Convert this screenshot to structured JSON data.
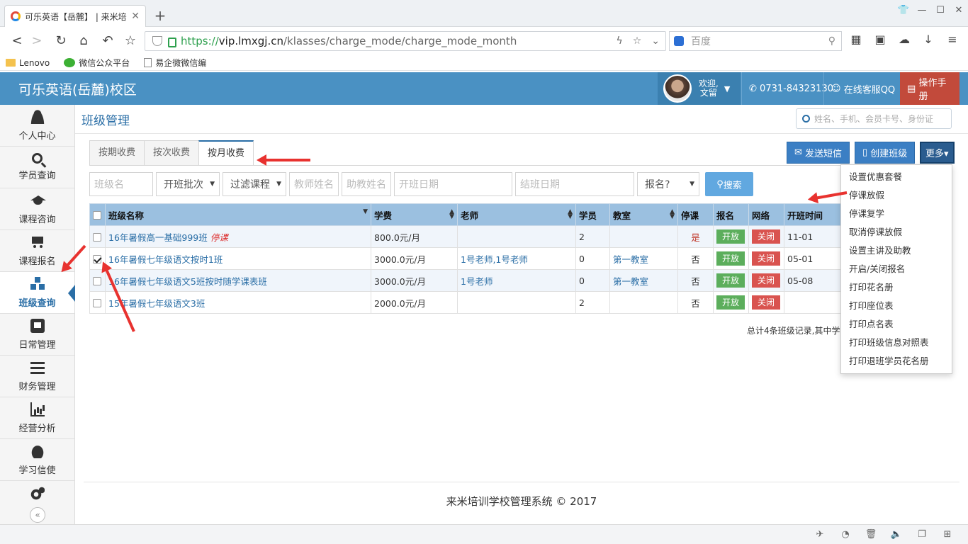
{
  "browser": {
    "tab_title": "可乐英语【岳麓】 | 来米培训",
    "url_protocol": "https://",
    "url_host": "vip.lmxgj.cn",
    "url_path": "/klasses/charge_mode/charge_mode_month",
    "search_placeholder": "百度",
    "bookmarks": [
      "Lenovo",
      "微信公众平台",
      "易企微微信编"
    ]
  },
  "header": {
    "title": "可乐英语(岳麓)校区",
    "welcome_line1": "欢迎,",
    "welcome_line2": "文留",
    "phone": "0731-84323130",
    "qq": "在线客服QQ",
    "manual": "操作手册"
  },
  "sidebar": {
    "items": [
      {
        "label": "个人中心",
        "icon": "user-icon"
      },
      {
        "label": "学员查询",
        "icon": "search-icon"
      },
      {
        "label": "课程咨询",
        "icon": "graduation-cap-icon"
      },
      {
        "label": "课程报名",
        "icon": "cart-icon"
      },
      {
        "label": "班级查询",
        "icon": "cubes-icon",
        "active": true
      },
      {
        "label": "日常管理",
        "icon": "daily-icon"
      },
      {
        "label": "财务管理",
        "icon": "bars-icon"
      },
      {
        "label": "经营分析",
        "icon": "chart-icon"
      },
      {
        "label": "学习信使",
        "icon": "twitter-icon"
      }
    ],
    "collapse": "«"
  },
  "page": {
    "title": "班级管理",
    "search_placeholder": "姓名、手机、会员卡号、身份证",
    "tabs": [
      "按期收费",
      "按次收费",
      "按月收费"
    ],
    "buttons": {
      "sms": "发送短信",
      "create": "创建班级",
      "more": "更多▾"
    },
    "filters": {
      "class_name": "班级名",
      "batch": "开班批次",
      "course": "过滤课程",
      "teacher": "教师姓名",
      "assistant": "助教姓名",
      "start_date": "开班日期",
      "end_date": "结班日期",
      "enroll": "报名?",
      "search": "搜索"
    },
    "table": {
      "headers": [
        "班级名称",
        "学费",
        "老师",
        "学员",
        "教室",
        "停课",
        "报名",
        "网络",
        "开班时间"
      ],
      "rows": [
        {
          "name": "16年暑假高一基础999班",
          "tag": "停课",
          "fee": "800.0元/月",
          "teacher": "",
          "students": "2",
          "room": "",
          "stopped": "是",
          "enroll": "开放",
          "net": "关闭",
          "start": "11-01",
          "checked": false
        },
        {
          "name": "16年暑假七年级语文按时1班",
          "tag": "",
          "fee": "3000.0元/月",
          "teacher": "1号老师,1号老师",
          "students": "0",
          "room": "第一教室",
          "stopped": "否",
          "enroll": "开放",
          "net": "关闭",
          "start": "05-01",
          "checked": true
        },
        {
          "name": "16年暑假七年级语文5班按时随学课表班",
          "tag": "",
          "fee": "3000.0元/月",
          "teacher": "1号老师",
          "students": "0",
          "room": "第一教室",
          "stopped": "否",
          "enroll": "开放",
          "net": "关闭",
          "start": "05-08",
          "checked": false
        },
        {
          "name": "15年暑假七年级语文3班",
          "tag": "",
          "fee": "2000.0元/月",
          "teacher": "",
          "students": "2",
          "room": "",
          "stopped": "否",
          "enroll": "开放",
          "net": "关闭",
          "start": "",
          "checked": false
        }
      ]
    },
    "total_text": "总计4条班级记录,其中学",
    "more_menu": [
      "设置优惠套餐",
      "停课放假",
      "停课复学",
      "取消停课放假",
      "设置主讲及助教",
      "开启/关闭报名",
      "打印花名册",
      "打印座位表",
      "打印点名表",
      "打印班级信息对照表",
      "打印退班学员花名册"
    ],
    "footer": "来米培训学校管理系统 © 2017"
  }
}
